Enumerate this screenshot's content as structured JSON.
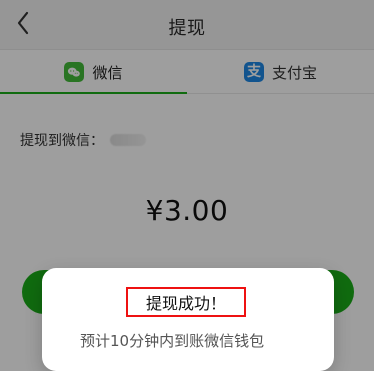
{
  "header": {
    "title": "提现"
  },
  "tabs": [
    {
      "label": "微信",
      "icon": "wechat-icon"
    },
    {
      "label": "支付宝",
      "icon": "alipay-icon",
      "icon_text": "支"
    }
  ],
  "withdraw": {
    "to_label": "提现到微信："
  },
  "amount": {
    "display": "¥3.00"
  },
  "toast": {
    "title": "提现成功！",
    "subtitle": "预计10分钟内到账微信钱包"
  },
  "colors": {
    "accent_green": "#1aad19",
    "alipay_blue": "#1e88e5",
    "toast_highlight_red": "#e11111"
  }
}
